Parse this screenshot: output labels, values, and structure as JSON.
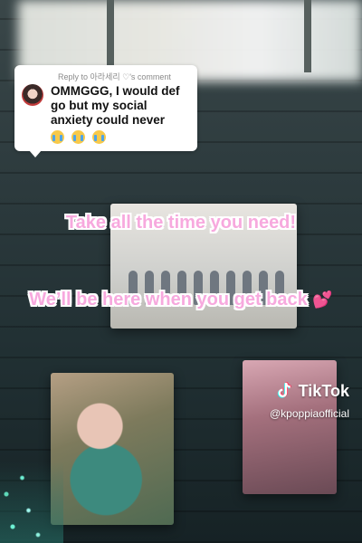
{
  "reply": {
    "header": "Reply to 아라세리 ♡'s comment",
    "text": "OMMGGG, I would def go but my social anxiety could never",
    "emojis": [
      "loudly-crying-face",
      "loudly-crying-face",
      "loudly-crying-face"
    ]
  },
  "overlay": {
    "line1": "Take all the time you need!",
    "line2": "We’ll be here when you get back",
    "heart_icon": "two-hearts-icon"
  },
  "watermark": {
    "brand": "TikTok",
    "handle": "@kpoppiaofficial",
    "logo_icon": "tiktok-logo-icon"
  },
  "colors": {
    "overlay_text": "#f7a9de",
    "overlay_outline": "#ffffff",
    "heart": "#ff4fa3"
  }
}
